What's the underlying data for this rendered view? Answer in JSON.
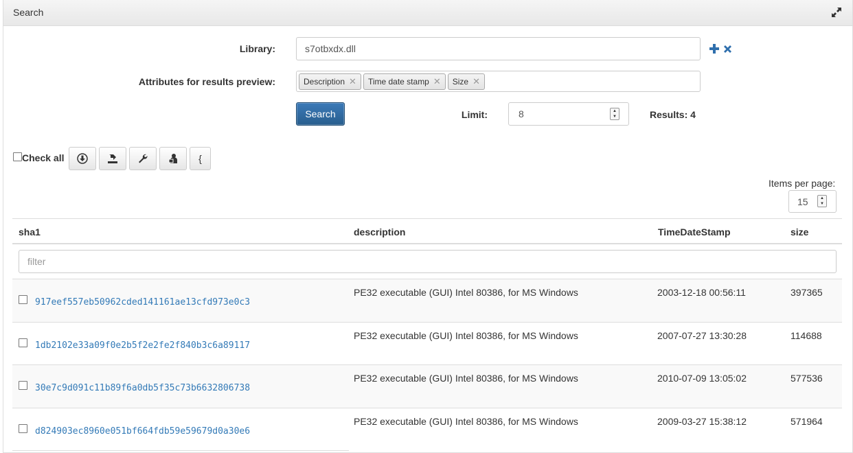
{
  "panel": {
    "title": "Search"
  },
  "form": {
    "library_label": "Library:",
    "library_value": "s7otbxdx.dll",
    "attributes_label": "Attributes for results preview:",
    "attribute_tags": [
      "Description",
      "Time date stamp",
      "Size"
    ],
    "search_button": "Search",
    "limit_label": "Limit:",
    "limit_value": "8",
    "results_text": "Results: 4"
  },
  "toolbar": {
    "check_all_label": "Check all",
    "buttons": [
      "download-icon",
      "export-icon",
      "wrench-icon",
      "user-lock-icon",
      "{"
    ]
  },
  "pager": {
    "items_per_page_label": "Items per page:",
    "items_per_page_value": "15"
  },
  "table": {
    "columns": [
      "sha1",
      "description",
      "TimeDateStamp",
      "size"
    ],
    "filter_placeholder": "filter",
    "rows": [
      {
        "sha1": "917eef557eb50962cded141161ae13cfd973e0c3",
        "description": "PE32 executable (GUI) Intel 80386, for MS Windows",
        "timestamp": "2003-12-18 00:56:11",
        "size": "397365"
      },
      {
        "sha1": "1db2102e33a09f0e2b5f2e2fe2f840b3c6a89117",
        "description": "PE32 executable (GUI) Intel 80386, for MS Windows",
        "timestamp": "2007-07-27 13:30:28",
        "size": "114688"
      },
      {
        "sha1": "30e7c9d091c11b89f6a0db5f35c73b6632806738",
        "description": "PE32 executable (GUI) Intel 80386, for MS Windows",
        "timestamp": "2010-07-09 13:05:02",
        "size": "577536"
      },
      {
        "sha1": "d824903ec8960e051bf664fdb59e59679d0a30e6",
        "description": "PE32 executable (GUI) Intel 80386, for MS Windows",
        "timestamp": "2009-03-27 15:38:12",
        "size": "571964"
      }
    ]
  },
  "colors": {
    "link": "#337ab7",
    "primary": "#285e8e",
    "icon_blue": "#2f6fad"
  }
}
